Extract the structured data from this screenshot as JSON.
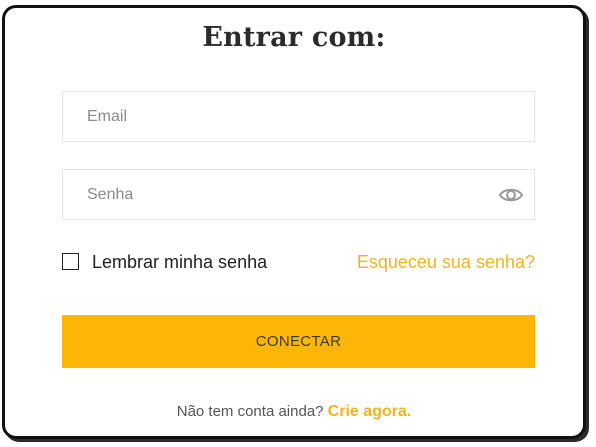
{
  "login_form": {
    "title": "Entrar com:",
    "email": {
      "placeholder": "Email",
      "value": ""
    },
    "password": {
      "placeholder": "Senha",
      "value": "",
      "toggle_icon": "eye-icon"
    },
    "remember": {
      "label": "Lembrar minha senha",
      "checked": false
    },
    "forgot_link": "Esqueceu sua senha?",
    "submit_label": "CONECTAR",
    "signup_prompt": "Não tem conta ainda?",
    "signup_link": "Crie agora."
  },
  "colors": {
    "accent": "#fdb608",
    "link": "#f0b323",
    "title": "#2b2b2b",
    "border": "#111111"
  }
}
